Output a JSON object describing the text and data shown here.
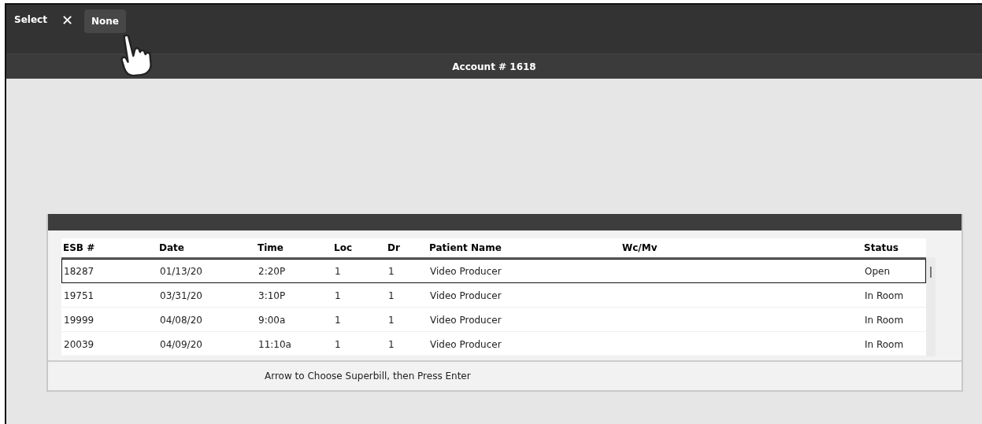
{
  "toolbar": {
    "title": "Select",
    "close_label": "✕",
    "button": "None"
  },
  "account_bar": {
    "title": "Account # 1618"
  },
  "table": {
    "columns": [
      "ESB #",
      "Date",
      "Time",
      "Loc",
      "Dr",
      "Patient Name",
      "Wc/Mv",
      "Status"
    ],
    "rows": [
      {
        "selected": true,
        "cells": [
          "18287",
          "01/13/20",
          "2:20P",
          "1",
          "1",
          "Video Producer",
          "",
          "Open"
        ]
      },
      {
        "selected": false,
        "cells": [
          "19751",
          "03/31/20",
          "3:10P",
          "1",
          "1",
          "Video Producer",
          "",
          "In Room"
        ]
      },
      {
        "selected": false,
        "cells": [
          "19999",
          "04/08/20",
          "9:00a",
          "1",
          "1",
          "Video Producer",
          "",
          "In Room"
        ]
      },
      {
        "selected": false,
        "cells": [
          "20039",
          "04/09/20",
          "11:10a",
          "1",
          "1",
          "Video Producer",
          "",
          "In Room"
        ]
      }
    ]
  },
  "status_bar": {
    "text": "Arrow to Choose Superbill, then Press Enter"
  }
}
